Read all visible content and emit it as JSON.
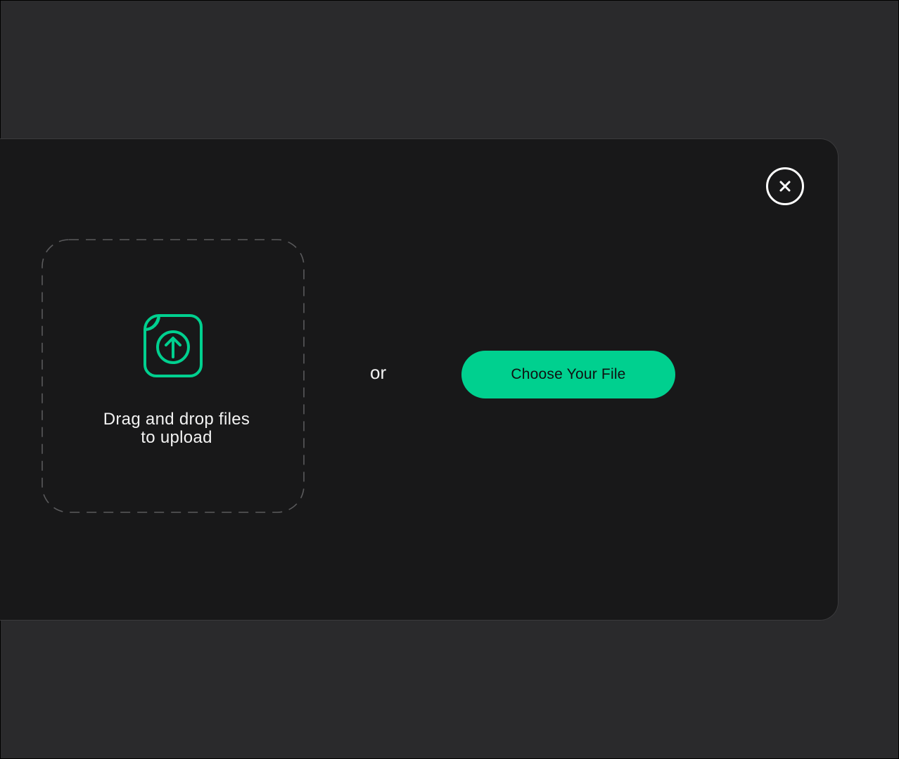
{
  "dialog": {
    "dropzone_text": "Drag and drop files\nto upload",
    "or_text": "or",
    "choose_button_label": "Choose Your File",
    "close_icon": "close-icon",
    "upload_icon": "upload-file-icon"
  },
  "colors": {
    "accent": "#00d08f",
    "background": "#2a2a2c",
    "modal_background": "#181819",
    "text": "#f2f2f2"
  }
}
